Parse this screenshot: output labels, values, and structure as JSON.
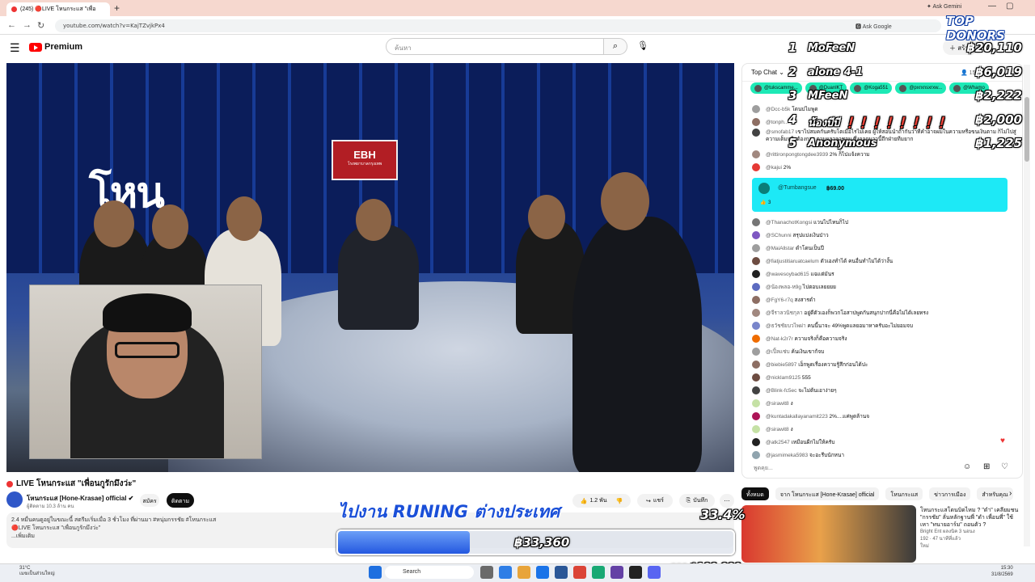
{
  "browser": {
    "tab_title": "(245) 🔴LIVE โหนกระแส \"เพื่อ",
    "url": "youtube.com/watch?v=KajTZvjkPx4",
    "ask_gemini": "Ask Gemini",
    "ask_google": "Ask Google"
  },
  "header": {
    "logo": "Premium",
    "search_placeholder": "ค้นหา",
    "create_label": "สร้าง"
  },
  "video": {
    "title": "LIVE โหนกระแส \"เพื่อนกูรักมึงว่ะ\"",
    "channel": "โหนกระแส [Hone-Krasae] official",
    "subscribers": "ผู้ติดตาม 10.3 ล้าน คน",
    "join_label": "สมัคร",
    "subscribe_label": "ติดตาม",
    "likes": "1.2 พัน",
    "share_label": "แชร์",
    "save_label": "บันทึก",
    "description_line1": "2.4 หมื่นคนดูอยู่ในขณะนี้  สตรีมเริ่มเมื่อ 3 ชั่วโมง ที่ผ่านมา  #หนุ่มกรรชัย #โหนกระแส",
    "description_line2": "🔴LIVE โหนกระแส \"เพื่อนกูรักมึงว่ะ\"",
    "description_more": "...เพิ่มเติม",
    "set_logo": "โหน",
    "set_sign": "EBH",
    "set_sign_sub": "โรงพยาบาลกรุงเทพ"
  },
  "chat": {
    "mode": "Top Chat",
    "viewers": "15K",
    "tickers": [
      {
        "name": "@tukscamme...",
        "color": "#1de9b6"
      },
      {
        "name": "@DuanlKT",
        "color": "#1de9b6"
      },
      {
        "name": "@Koga551",
        "color": "#1de9b6"
      },
      {
        "name": "@pxrxnsxrxw...",
        "color": "#1de9b6"
      },
      {
        "name": "@Whamo",
        "color": "#1de9b6"
      }
    ],
    "messages": [
      {
        "author": "@Dcc-b5k",
        "text": "โดนบ่ไมพูด",
        "color": "#9e9e9e"
      },
      {
        "author": "@tonph...",
        "text": "",
        "color": "#8d6e63"
      },
      {
        "author": "@smofab17",
        "text": "เขาไปสมคกันครับโตเมื่อไรไม่เคย ผู้ให้สอนนำถ้ากันว่าทีคำอาจผมในความหรือขนเงินตาม ก็ไม่ไปสู่ความเต็มหรือต้องการ ตามผลวลาชอบ ซึ่งออกมาวนี้ถึกฝ่ายทีมยาก",
        "color": "#424242"
      },
      {
        "author": "@rittironpongtongdee3939",
        "text": "2% ก็ไปแจ้งความ",
        "color": "#a1887f"
      },
      {
        "author": "@kajui",
        "text": "2%",
        "color": "#e53935"
      }
    ],
    "superchat": {
      "author": "@Tumbangsue",
      "amount": "฿69.00",
      "likes": "3"
    },
    "messages2": [
      {
        "author": "@ThanachotKongsi",
        "text": "แวนไปไหนก็ไป",
        "color": "#757575"
      },
      {
        "author": "@SChunni",
        "text": "สรุปแบ่งเงินป่าว",
        "color": "#7e57c2"
      },
      {
        "author": "@MaiAllstar",
        "text": "ดำโดนเป็นปี",
        "color": "#9e9e9e"
      },
      {
        "author": "@fiatjustitiaruatcaelum",
        "text": "ตัวเองทำได้ คนอื่นทำไม่ได้ว่างั้น",
        "color": "#6d4c41"
      },
      {
        "author": "@wavesoybad615",
        "text": "แฉแต่มันร",
        "color": "#212121"
      },
      {
        "author": "@น้องพลอ-ห9g",
        "text": "ไปตอบเลยยยย",
        "color": "#5c6bc0"
      },
      {
        "author": "@FgY6-r7q",
        "text": "สงสารดำ",
        "color": "#8d6e63"
      },
      {
        "author": "@จีราลวนิชกุลา",
        "text": "อยู่ดีตัวเองก็พวกโอสาปพูดกันสนุกปากนี่คือไม่ได้เลยทรง",
        "color": "#a1887f"
      },
      {
        "author": "@ธวัชชัยบวไพผ่า",
        "text": "คนนี้นาจะ 49%พูดแลยอมาหาครับอะไม่ยอมจบ",
        "color": "#7986cb"
      },
      {
        "author": "@Nat-k2r7r",
        "text": "ความจริงก็คือความจริง",
        "color": "#ef6c00"
      },
      {
        "author": "@เปิ้ลแซ่บ",
        "text": "ค้นเงินเขาก้จบ",
        "color": "#9e9e9e"
      },
      {
        "author": "@biebie5897",
        "text": "เอ็กพูดเรื่องความรู้สึกก่อนได้ปะ",
        "color": "#8d6e63"
      },
      {
        "author": "@nicklam9125",
        "text": "555",
        "color": "#6d4c41"
      },
      {
        "author": "@Blink-fc5ec",
        "text": "จะไม่ต้นเอาง่ายๆ",
        "color": "#424242"
      },
      {
        "author": "@sirawit8",
        "text": "ง",
        "color": "#c5e1a5"
      },
      {
        "author": "@kuntadakallayanamit223",
        "text": "2%....แค่พูดล้านจ",
        "color": "#ad1457"
      },
      {
        "author": "@sirawit8",
        "text": "ง",
        "color": "#c5e1a5"
      },
      {
        "author": "@atk2547",
        "text": "เหมือนผีกไม่ให้ครับ",
        "color": "#212121"
      },
      {
        "author": "@jasmimeka5983",
        "text": "จะอะรีบนักหนา",
        "color": "#90a4ae"
      }
    ],
    "input_placeholder": "พูดคุย..."
  },
  "recommend": {
    "chips": [
      "ทั้งหมด",
      "จาก โหนกระแส [Hone-Krasae] official",
      "โหนกระแส",
      "ข่าวการเมือง",
      "สำหรับคุณ"
    ],
    "title": "โหนกระแสโดนบิดไหม ? \"ดำ\" เคลียมชน \"กรรชัย\" ลั่นหลักฐานพี่ \"ดำ เพื่อนพี่\" ใช้เหา \"ทนายอาร์ม\" ถอนตัว ?",
    "channel": "Bright Ent ผลงนิค 3 นอนง",
    "stats": "192 · 47 นาทีที่แล้ว",
    "badge": "ใหม่"
  },
  "overlay": {
    "heading": "TOP DONORS",
    "donors": [
      {
        "rank": "1",
        "name": "MoFeeN",
        "amount": "฿20,110"
      },
      {
        "rank": "2",
        "name": "alone 4-1",
        "amount": "฿6,019"
      },
      {
        "rank": "3",
        "name": "MFeeN",
        "amount": "฿2,222"
      },
      {
        "rank": "4",
        "name": "น้องบีบี ❗❗❗❗❗❗❗❗",
        "amount": "฿2,000"
      },
      {
        "rank": "5",
        "name": "Anonymous",
        "amount": "฿1,225"
      }
    ],
    "goal_title": "ไปงาน RUNING ต่างประเทศ",
    "goal_percent": "33.4%",
    "goal_fraction": 0.334,
    "goal_amount": "฿33,360",
    "goal_target": "จาก ฿100,000"
  },
  "taskbar": {
    "temp": "31°C",
    "weather": "เมฆเป็นส่วนใหญ่",
    "search": "Search",
    "time": "15:30",
    "date": "31/8/2569"
  }
}
